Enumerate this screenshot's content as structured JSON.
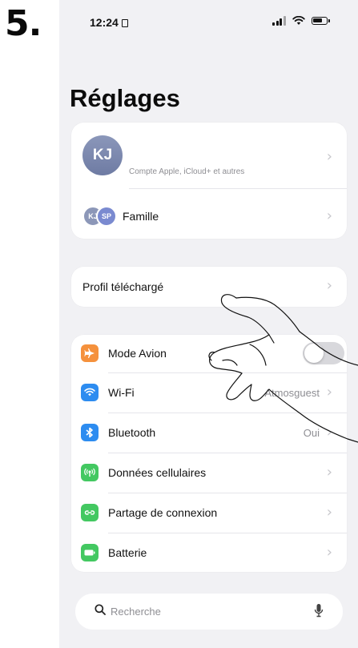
{
  "step_number": "5.",
  "status_bar": {
    "time": "12:24"
  },
  "title": "Réglages",
  "account": {
    "initials": "KJ",
    "subtitle": "Compte Apple, iCloud+ et autres",
    "family_label": "Famille",
    "family_avatars": [
      "KJ",
      "SP"
    ]
  },
  "profile_row": {
    "label": "Profil téléchargé"
  },
  "settings": [
    {
      "label": "Mode Avion",
      "icon": "airplane-icon",
      "color": "#f5913c",
      "value": "",
      "toggle": "off"
    },
    {
      "label": "Wi-Fi",
      "icon": "wifi-icon",
      "color": "#2d8cf0",
      "value": "Atmosguest"
    },
    {
      "label": "Bluetooth",
      "icon": "bluetooth-icon",
      "color": "#2d8cf0",
      "value": "Oui"
    },
    {
      "label": "Données cellulaires",
      "icon": "cellular-icon",
      "color": "#43c861",
      "value": ""
    },
    {
      "label": "Partage de connexion",
      "icon": "hotspot-icon",
      "color": "#43c861",
      "value": ""
    },
    {
      "label": "Batterie",
      "icon": "battery-icon",
      "color": "#43c861",
      "value": ""
    }
  ],
  "search": {
    "placeholder": "Recherche"
  },
  "chevron": "›"
}
